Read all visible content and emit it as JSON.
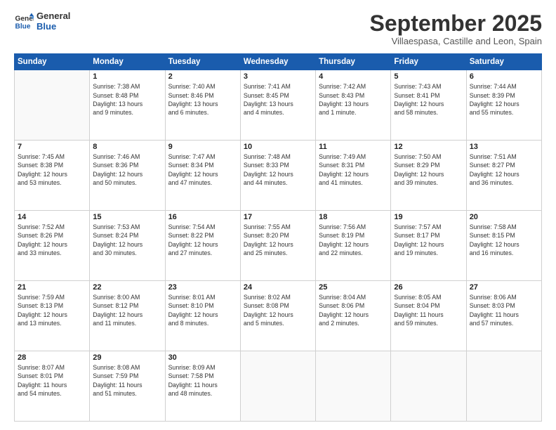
{
  "logo": {
    "line1": "General",
    "line2": "Blue"
  },
  "title": "September 2025",
  "subtitle": "Villaespasa, Castille and Leon, Spain",
  "weekdays": [
    "Sunday",
    "Monday",
    "Tuesday",
    "Wednesday",
    "Thursday",
    "Friday",
    "Saturday"
  ],
  "weeks": [
    [
      {
        "day": "",
        "info": ""
      },
      {
        "day": "1",
        "info": "Sunrise: 7:38 AM\nSunset: 8:48 PM\nDaylight: 13 hours\nand 9 minutes."
      },
      {
        "day": "2",
        "info": "Sunrise: 7:40 AM\nSunset: 8:46 PM\nDaylight: 13 hours\nand 6 minutes."
      },
      {
        "day": "3",
        "info": "Sunrise: 7:41 AM\nSunset: 8:45 PM\nDaylight: 13 hours\nand 4 minutes."
      },
      {
        "day": "4",
        "info": "Sunrise: 7:42 AM\nSunset: 8:43 PM\nDaylight: 13 hours\nand 1 minute."
      },
      {
        "day": "5",
        "info": "Sunrise: 7:43 AM\nSunset: 8:41 PM\nDaylight: 12 hours\nand 58 minutes."
      },
      {
        "day": "6",
        "info": "Sunrise: 7:44 AM\nSunset: 8:39 PM\nDaylight: 12 hours\nand 55 minutes."
      }
    ],
    [
      {
        "day": "7",
        "info": "Sunrise: 7:45 AM\nSunset: 8:38 PM\nDaylight: 12 hours\nand 53 minutes."
      },
      {
        "day": "8",
        "info": "Sunrise: 7:46 AM\nSunset: 8:36 PM\nDaylight: 12 hours\nand 50 minutes."
      },
      {
        "day": "9",
        "info": "Sunrise: 7:47 AM\nSunset: 8:34 PM\nDaylight: 12 hours\nand 47 minutes."
      },
      {
        "day": "10",
        "info": "Sunrise: 7:48 AM\nSunset: 8:33 PM\nDaylight: 12 hours\nand 44 minutes."
      },
      {
        "day": "11",
        "info": "Sunrise: 7:49 AM\nSunset: 8:31 PM\nDaylight: 12 hours\nand 41 minutes."
      },
      {
        "day": "12",
        "info": "Sunrise: 7:50 AM\nSunset: 8:29 PM\nDaylight: 12 hours\nand 39 minutes."
      },
      {
        "day": "13",
        "info": "Sunrise: 7:51 AM\nSunset: 8:27 PM\nDaylight: 12 hours\nand 36 minutes."
      }
    ],
    [
      {
        "day": "14",
        "info": "Sunrise: 7:52 AM\nSunset: 8:26 PM\nDaylight: 12 hours\nand 33 minutes."
      },
      {
        "day": "15",
        "info": "Sunrise: 7:53 AM\nSunset: 8:24 PM\nDaylight: 12 hours\nand 30 minutes."
      },
      {
        "day": "16",
        "info": "Sunrise: 7:54 AM\nSunset: 8:22 PM\nDaylight: 12 hours\nand 27 minutes."
      },
      {
        "day": "17",
        "info": "Sunrise: 7:55 AM\nSunset: 8:20 PM\nDaylight: 12 hours\nand 25 minutes."
      },
      {
        "day": "18",
        "info": "Sunrise: 7:56 AM\nSunset: 8:19 PM\nDaylight: 12 hours\nand 22 minutes."
      },
      {
        "day": "19",
        "info": "Sunrise: 7:57 AM\nSunset: 8:17 PM\nDaylight: 12 hours\nand 19 minutes."
      },
      {
        "day": "20",
        "info": "Sunrise: 7:58 AM\nSunset: 8:15 PM\nDaylight: 12 hours\nand 16 minutes."
      }
    ],
    [
      {
        "day": "21",
        "info": "Sunrise: 7:59 AM\nSunset: 8:13 PM\nDaylight: 12 hours\nand 13 minutes."
      },
      {
        "day": "22",
        "info": "Sunrise: 8:00 AM\nSunset: 8:12 PM\nDaylight: 12 hours\nand 11 minutes."
      },
      {
        "day": "23",
        "info": "Sunrise: 8:01 AM\nSunset: 8:10 PM\nDaylight: 12 hours\nand 8 minutes."
      },
      {
        "day": "24",
        "info": "Sunrise: 8:02 AM\nSunset: 8:08 PM\nDaylight: 12 hours\nand 5 minutes."
      },
      {
        "day": "25",
        "info": "Sunrise: 8:04 AM\nSunset: 8:06 PM\nDaylight: 12 hours\nand 2 minutes."
      },
      {
        "day": "26",
        "info": "Sunrise: 8:05 AM\nSunset: 8:04 PM\nDaylight: 11 hours\nand 59 minutes."
      },
      {
        "day": "27",
        "info": "Sunrise: 8:06 AM\nSunset: 8:03 PM\nDaylight: 11 hours\nand 57 minutes."
      }
    ],
    [
      {
        "day": "28",
        "info": "Sunrise: 8:07 AM\nSunset: 8:01 PM\nDaylight: 11 hours\nand 54 minutes."
      },
      {
        "day": "29",
        "info": "Sunrise: 8:08 AM\nSunset: 7:59 PM\nDaylight: 11 hours\nand 51 minutes."
      },
      {
        "day": "30",
        "info": "Sunrise: 8:09 AM\nSunset: 7:58 PM\nDaylight: 11 hours\nand 48 minutes."
      },
      {
        "day": "",
        "info": ""
      },
      {
        "day": "",
        "info": ""
      },
      {
        "day": "",
        "info": ""
      },
      {
        "day": "",
        "info": ""
      }
    ]
  ]
}
